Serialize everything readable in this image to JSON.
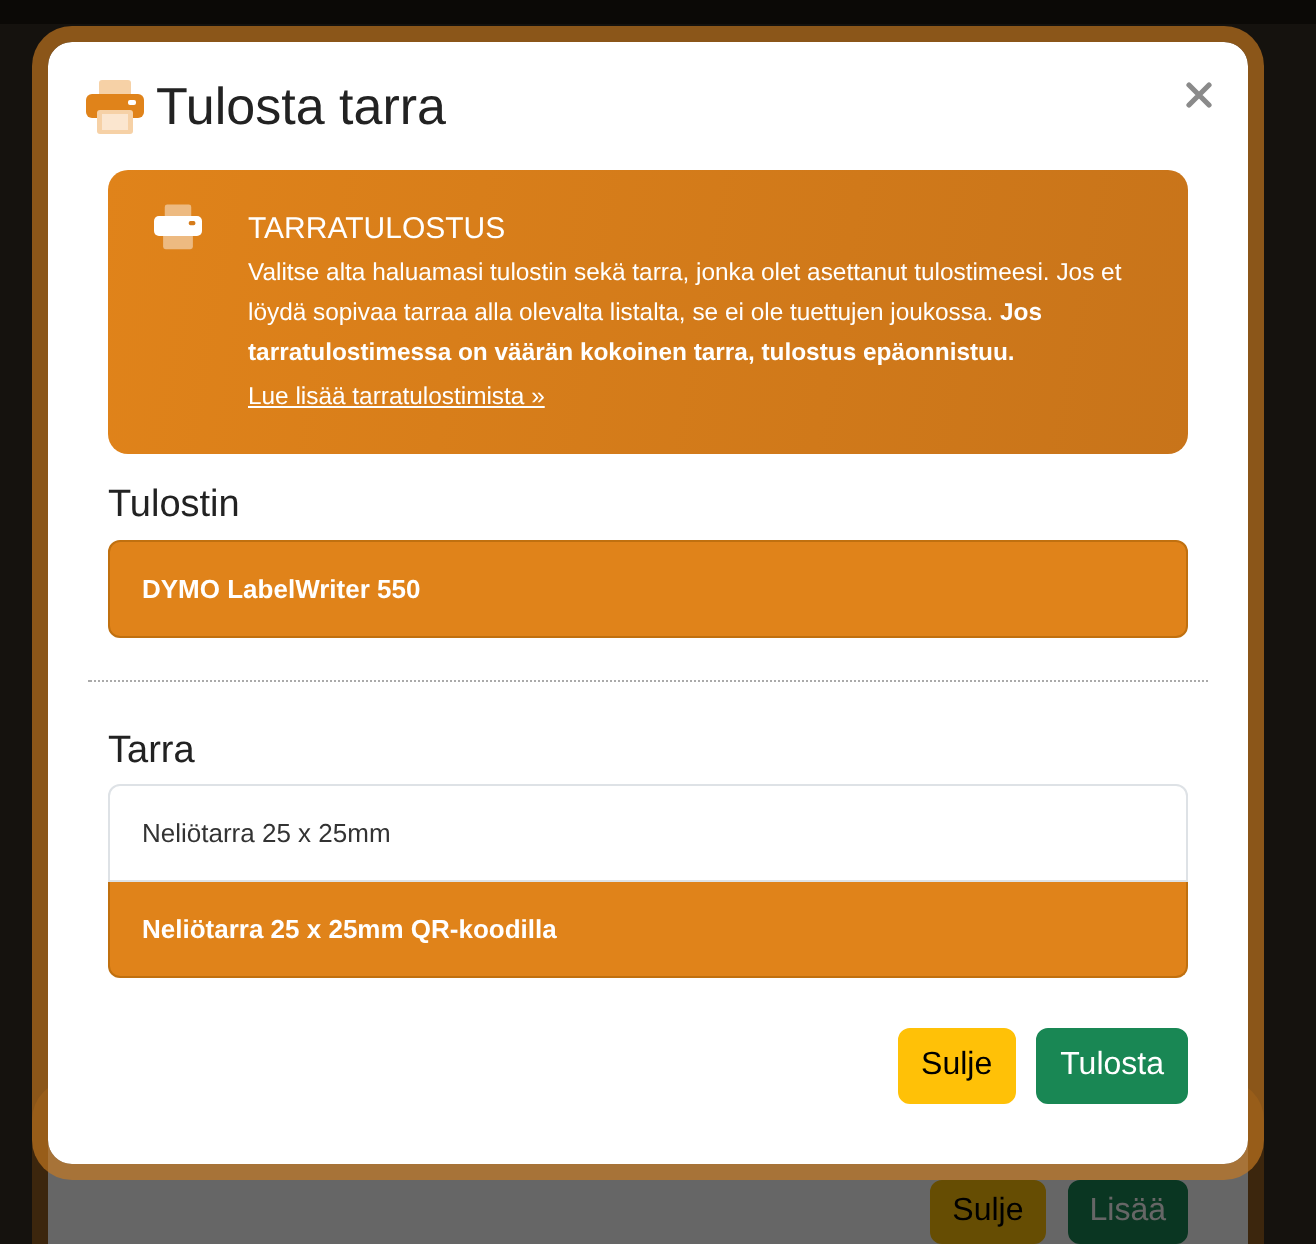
{
  "background_dialog": {
    "buttons": [
      {
        "label": "Sulje",
        "kind": "close"
      },
      {
        "label": "Lisää",
        "kind": "add"
      }
    ]
  },
  "dialog": {
    "title": "Tulosta tarra"
  },
  "notice": {
    "title": "TARRATULOSTUS",
    "text": "Valitse alta haluamasi tulostin sekä tarra, jonka olet asettanut tulostimeesi. Jos et löydä sopivaa tarraa alla olevalta listalta, se ei ole tuettujen joukossa. **Jos tarratulostimessa on väärän kokoinen tarra, tulostus epäonnistuu.**",
    "link": "Lue lisää tarratulostimista »"
  },
  "printer_section": {
    "label": "Tulostin",
    "options": [
      {
        "label": "DYMO LabelWriter 550",
        "selected": true
      }
    ]
  },
  "label_section": {
    "label": "Tarra",
    "options": [
      {
        "label": "Neliötarra 25 x 25mm",
        "selected": false
      },
      {
        "label": "Neliötarra 25 x 25mm QR-koodilla",
        "selected": true
      }
    ]
  },
  "buttons": [
    {
      "label": "Sulje",
      "kind": "close"
    },
    {
      "label": "Tulosta",
      "kind": "print"
    }
  ]
}
